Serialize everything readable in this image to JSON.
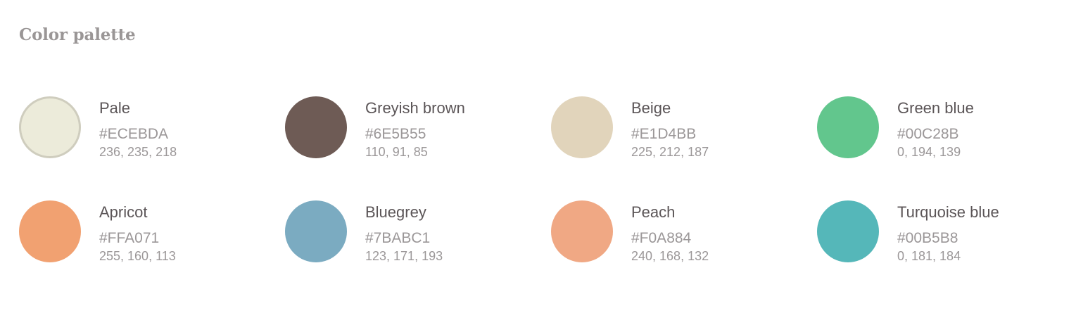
{
  "title": "Color palette",
  "colors": [
    {
      "name": "Pale",
      "hex": "#ECEBDA",
      "rgb": "236, 235, 218",
      "color": "#ECEBDA",
      "bordered": true
    },
    {
      "name": "Greyish brown",
      "hex": "#6E5B55",
      "rgb": "110, 91, 85",
      "color": "#6E5B55",
      "bordered": false
    },
    {
      "name": "Beige",
      "hex": "#E1D4BB",
      "rgb": "225, 212, 187",
      "color": "#E1D4BB",
      "bordered": false
    },
    {
      "name": "Green blue",
      "hex": "#00C28B",
      "rgb": "0, 194, 139",
      "color": "#62C68D",
      "bordered": false
    },
    {
      "name": "Apricot",
      "hex": "#FFA071",
      "rgb": "255, 160, 113",
      "color": "#F1A171",
      "bordered": false
    },
    {
      "name": "Bluegrey",
      "hex": "#7BABC1",
      "rgb": "123, 171, 193",
      "color": "#7BABC1",
      "bordered": false
    },
    {
      "name": "Peach",
      "hex": "#F0A884",
      "rgb": "240, 168, 132",
      "color": "#F0A884",
      "bordered": false
    },
    {
      "name": "Turquoise blue",
      "hex": "#00B5B8",
      "rgb": "0, 181, 184",
      "color": "#55B7B9",
      "bordered": false
    }
  ]
}
